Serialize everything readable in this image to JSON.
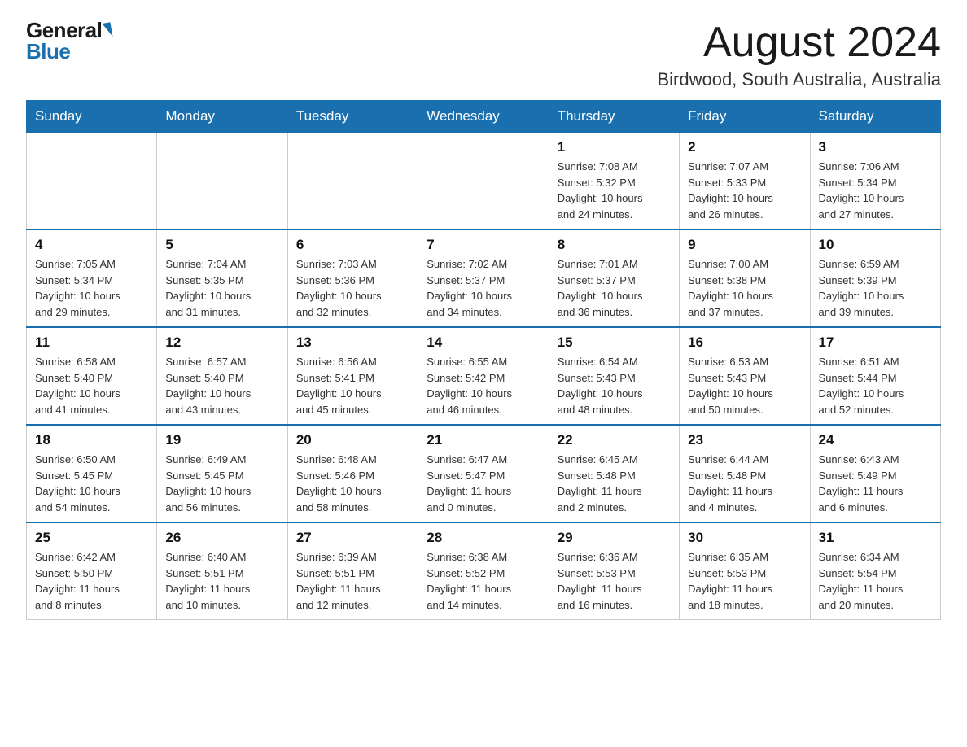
{
  "logo": {
    "general": "General",
    "blue": "Blue"
  },
  "header": {
    "month_year": "August 2024",
    "location": "Birdwood, South Australia, Australia"
  },
  "weekdays": [
    "Sunday",
    "Monday",
    "Tuesday",
    "Wednesday",
    "Thursday",
    "Friday",
    "Saturday"
  ],
  "weeks": [
    [
      {
        "day": "",
        "info": ""
      },
      {
        "day": "",
        "info": ""
      },
      {
        "day": "",
        "info": ""
      },
      {
        "day": "",
        "info": ""
      },
      {
        "day": "1",
        "info": "Sunrise: 7:08 AM\nSunset: 5:32 PM\nDaylight: 10 hours\nand 24 minutes."
      },
      {
        "day": "2",
        "info": "Sunrise: 7:07 AM\nSunset: 5:33 PM\nDaylight: 10 hours\nand 26 minutes."
      },
      {
        "day": "3",
        "info": "Sunrise: 7:06 AM\nSunset: 5:34 PM\nDaylight: 10 hours\nand 27 minutes."
      }
    ],
    [
      {
        "day": "4",
        "info": "Sunrise: 7:05 AM\nSunset: 5:34 PM\nDaylight: 10 hours\nand 29 minutes."
      },
      {
        "day": "5",
        "info": "Sunrise: 7:04 AM\nSunset: 5:35 PM\nDaylight: 10 hours\nand 31 minutes."
      },
      {
        "day": "6",
        "info": "Sunrise: 7:03 AM\nSunset: 5:36 PM\nDaylight: 10 hours\nand 32 minutes."
      },
      {
        "day": "7",
        "info": "Sunrise: 7:02 AM\nSunset: 5:37 PM\nDaylight: 10 hours\nand 34 minutes."
      },
      {
        "day": "8",
        "info": "Sunrise: 7:01 AM\nSunset: 5:37 PM\nDaylight: 10 hours\nand 36 minutes."
      },
      {
        "day": "9",
        "info": "Sunrise: 7:00 AM\nSunset: 5:38 PM\nDaylight: 10 hours\nand 37 minutes."
      },
      {
        "day": "10",
        "info": "Sunrise: 6:59 AM\nSunset: 5:39 PM\nDaylight: 10 hours\nand 39 minutes."
      }
    ],
    [
      {
        "day": "11",
        "info": "Sunrise: 6:58 AM\nSunset: 5:40 PM\nDaylight: 10 hours\nand 41 minutes."
      },
      {
        "day": "12",
        "info": "Sunrise: 6:57 AM\nSunset: 5:40 PM\nDaylight: 10 hours\nand 43 minutes."
      },
      {
        "day": "13",
        "info": "Sunrise: 6:56 AM\nSunset: 5:41 PM\nDaylight: 10 hours\nand 45 minutes."
      },
      {
        "day": "14",
        "info": "Sunrise: 6:55 AM\nSunset: 5:42 PM\nDaylight: 10 hours\nand 46 minutes."
      },
      {
        "day": "15",
        "info": "Sunrise: 6:54 AM\nSunset: 5:43 PM\nDaylight: 10 hours\nand 48 minutes."
      },
      {
        "day": "16",
        "info": "Sunrise: 6:53 AM\nSunset: 5:43 PM\nDaylight: 10 hours\nand 50 minutes."
      },
      {
        "day": "17",
        "info": "Sunrise: 6:51 AM\nSunset: 5:44 PM\nDaylight: 10 hours\nand 52 minutes."
      }
    ],
    [
      {
        "day": "18",
        "info": "Sunrise: 6:50 AM\nSunset: 5:45 PM\nDaylight: 10 hours\nand 54 minutes."
      },
      {
        "day": "19",
        "info": "Sunrise: 6:49 AM\nSunset: 5:45 PM\nDaylight: 10 hours\nand 56 minutes."
      },
      {
        "day": "20",
        "info": "Sunrise: 6:48 AM\nSunset: 5:46 PM\nDaylight: 10 hours\nand 58 minutes."
      },
      {
        "day": "21",
        "info": "Sunrise: 6:47 AM\nSunset: 5:47 PM\nDaylight: 11 hours\nand 0 minutes."
      },
      {
        "day": "22",
        "info": "Sunrise: 6:45 AM\nSunset: 5:48 PM\nDaylight: 11 hours\nand 2 minutes."
      },
      {
        "day": "23",
        "info": "Sunrise: 6:44 AM\nSunset: 5:48 PM\nDaylight: 11 hours\nand 4 minutes."
      },
      {
        "day": "24",
        "info": "Sunrise: 6:43 AM\nSunset: 5:49 PM\nDaylight: 11 hours\nand 6 minutes."
      }
    ],
    [
      {
        "day": "25",
        "info": "Sunrise: 6:42 AM\nSunset: 5:50 PM\nDaylight: 11 hours\nand 8 minutes."
      },
      {
        "day": "26",
        "info": "Sunrise: 6:40 AM\nSunset: 5:51 PM\nDaylight: 11 hours\nand 10 minutes."
      },
      {
        "day": "27",
        "info": "Sunrise: 6:39 AM\nSunset: 5:51 PM\nDaylight: 11 hours\nand 12 minutes."
      },
      {
        "day": "28",
        "info": "Sunrise: 6:38 AM\nSunset: 5:52 PM\nDaylight: 11 hours\nand 14 minutes."
      },
      {
        "day": "29",
        "info": "Sunrise: 6:36 AM\nSunset: 5:53 PM\nDaylight: 11 hours\nand 16 minutes."
      },
      {
        "day": "30",
        "info": "Sunrise: 6:35 AM\nSunset: 5:53 PM\nDaylight: 11 hours\nand 18 minutes."
      },
      {
        "day": "31",
        "info": "Sunrise: 6:34 AM\nSunset: 5:54 PM\nDaylight: 11 hours\nand 20 minutes."
      }
    ]
  ]
}
